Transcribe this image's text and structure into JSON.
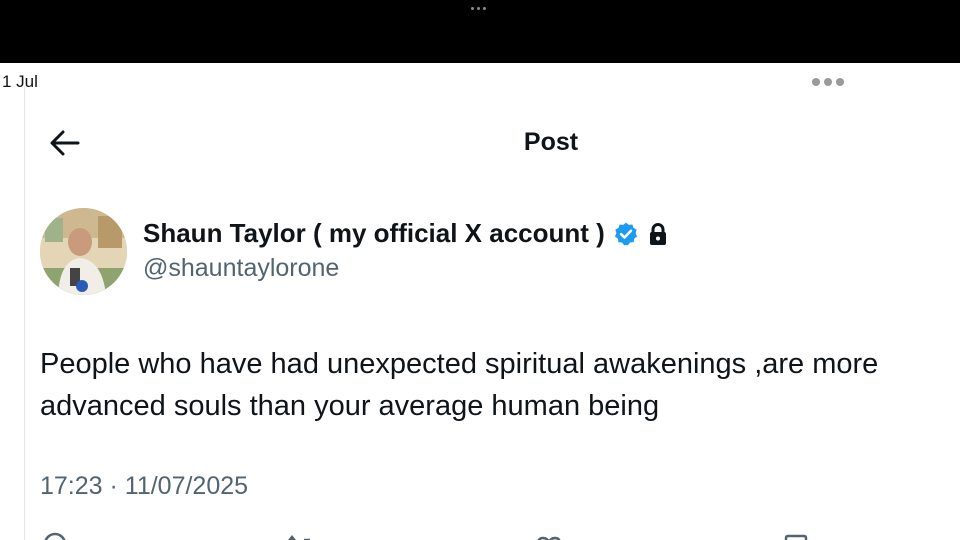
{
  "status_bar": {
    "date": "1 Jul"
  },
  "header": {
    "title": "Post"
  },
  "author": {
    "display_name": "Shaun Taylor ( my official X account )",
    "handle": "@shauntaylorone",
    "verified": true,
    "protected": true,
    "verified_color": "#1d9bf0"
  },
  "post": {
    "text": "People who have had unexpected spiritual awakenings ,are more advanced souls than your average human being",
    "timestamp": "17:23 · 11/07/2025"
  },
  "icons": {
    "back": "arrow-left-icon",
    "more": "more-horizontal-icon",
    "verified": "verified-badge-icon",
    "lock": "lock-icon",
    "actions": [
      "reply-icon",
      "repost-icon",
      "like-icon",
      "bookmark-icon"
    ]
  },
  "colors": {
    "text": "#0f1419",
    "muted": "#536471",
    "accent": "#1d9bf0",
    "top_bar": "#000000"
  }
}
